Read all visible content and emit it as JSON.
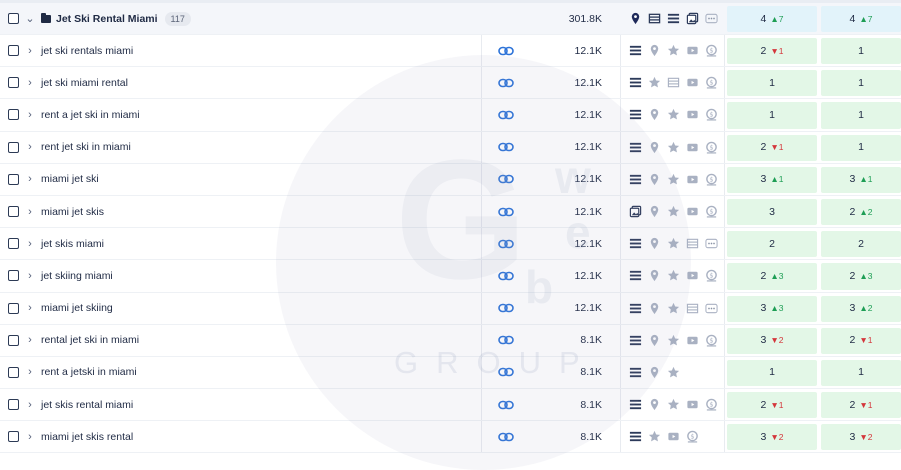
{
  "group": {
    "keyword": "Jet Ski Rental Miami",
    "count": "117",
    "volume": "301.8K",
    "features": [
      "map-pin-icon",
      "table-icon",
      "list-icon",
      "image-icon",
      "more-icon"
    ],
    "pos1": {
      "value": "4",
      "change": "7",
      "dir": "up"
    },
    "pos2": {
      "value": "4",
      "change": "7",
      "dir": "up"
    }
  },
  "rows": [
    {
      "keyword": "jet ski rentals miami",
      "volume": "12.1K",
      "features": [
        "list-icon",
        "map-pin-icon",
        "star-icon",
        "video-icon",
        "coin-icon"
      ],
      "pos1": {
        "value": "2",
        "change": "1",
        "dir": "down"
      },
      "pos2": {
        "value": "1",
        "change": "",
        "dir": ""
      }
    },
    {
      "keyword": "jet ski miami rental",
      "volume": "12.1K",
      "features": [
        "list-icon",
        "star-icon",
        "table-icon",
        "video-icon",
        "coin-icon"
      ],
      "pos1": {
        "value": "1",
        "change": "",
        "dir": ""
      },
      "pos2": {
        "value": "1",
        "change": "",
        "dir": ""
      }
    },
    {
      "keyword": "rent a jet ski in miami",
      "volume": "12.1K",
      "features": [
        "list-icon",
        "map-pin-icon",
        "star-icon",
        "video-icon",
        "coin-icon"
      ],
      "pos1": {
        "value": "1",
        "change": "",
        "dir": ""
      },
      "pos2": {
        "value": "1",
        "change": "",
        "dir": ""
      }
    },
    {
      "keyword": "rent jet ski in miami",
      "volume": "12.1K",
      "features": [
        "list-icon",
        "map-pin-icon",
        "star-icon",
        "video-icon",
        "coin-icon"
      ],
      "pos1": {
        "value": "2",
        "change": "1",
        "dir": "down"
      },
      "pos2": {
        "value": "1",
        "change": "",
        "dir": ""
      }
    },
    {
      "keyword": "miami jet ski",
      "volume": "12.1K",
      "features": [
        "list-icon",
        "map-pin-icon",
        "star-icon",
        "video-icon",
        "coin-icon"
      ],
      "pos1": {
        "value": "3",
        "change": "1",
        "dir": "up"
      },
      "pos2": {
        "value": "3",
        "change": "1",
        "dir": "up"
      }
    },
    {
      "keyword": "miami jet skis",
      "volume": "12.1K",
      "features": [
        "image-icon",
        "map-pin-icon",
        "star-icon",
        "video-icon",
        "coin-icon"
      ],
      "pos1": {
        "value": "3",
        "change": "",
        "dir": ""
      },
      "pos2": {
        "value": "2",
        "change": "2",
        "dir": "up"
      }
    },
    {
      "keyword": "jet skis miami",
      "volume": "12.1K",
      "features": [
        "list-icon",
        "map-pin-icon",
        "star-icon",
        "table-icon",
        "more-icon"
      ],
      "pos1": {
        "value": "2",
        "change": "",
        "dir": ""
      },
      "pos2": {
        "value": "2",
        "change": "",
        "dir": ""
      }
    },
    {
      "keyword": "jet skiing miami",
      "volume": "12.1K",
      "features": [
        "list-icon",
        "map-pin-icon",
        "star-icon",
        "video-icon",
        "coin-icon"
      ],
      "pos1": {
        "value": "2",
        "change": "3",
        "dir": "up"
      },
      "pos2": {
        "value": "2",
        "change": "3",
        "dir": "up"
      }
    },
    {
      "keyword": "miami jet skiing",
      "volume": "12.1K",
      "features": [
        "list-icon",
        "map-pin-icon",
        "star-icon",
        "table-icon",
        "more-icon"
      ],
      "pos1": {
        "value": "3",
        "change": "3",
        "dir": "up"
      },
      "pos2": {
        "value": "3",
        "change": "2",
        "dir": "up"
      }
    },
    {
      "keyword": "rental jet ski in miami",
      "volume": "8.1K",
      "features": [
        "list-icon",
        "map-pin-icon",
        "star-icon",
        "video-icon",
        "coin-icon"
      ],
      "pos1": {
        "value": "3",
        "change": "2",
        "dir": "down"
      },
      "pos2": {
        "value": "2",
        "change": "1",
        "dir": "down"
      }
    },
    {
      "keyword": "rent a jetski in miami",
      "volume": "8.1K",
      "features": [
        "list-icon",
        "map-pin-icon",
        "star-icon"
      ],
      "pos1": {
        "value": "1",
        "change": "",
        "dir": ""
      },
      "pos2": {
        "value": "1",
        "change": "",
        "dir": ""
      }
    },
    {
      "keyword": "jet skis rental miami",
      "volume": "8.1K",
      "features": [
        "list-icon",
        "map-pin-icon",
        "star-icon",
        "video-icon",
        "coin-icon"
      ],
      "pos1": {
        "value": "2",
        "change": "1",
        "dir": "down"
      },
      "pos2": {
        "value": "2",
        "change": "1",
        "dir": "down"
      }
    },
    {
      "keyword": "miami jet skis rental",
      "volume": "8.1K",
      "features": [
        "list-icon",
        "star-icon",
        "video-icon",
        "coin-icon"
      ],
      "pos1": {
        "value": "3",
        "change": "2",
        "dir": "down"
      },
      "pos2": {
        "value": "3",
        "change": "2",
        "dir": "down"
      }
    }
  ],
  "watermark": {
    "letter": "G",
    "side_letters": [
      "w",
      "e",
      "b"
    ],
    "word": "GROUP"
  },
  "colors": {
    "link": "#2d73d8",
    "icon": "#2c3a5a",
    "icon_muted": "#a9b1c2",
    "up": "#1e9e55",
    "down": "#d4363b",
    "cell_green": "#e3f7e7",
    "cell_blue": "#e2f3fa"
  }
}
